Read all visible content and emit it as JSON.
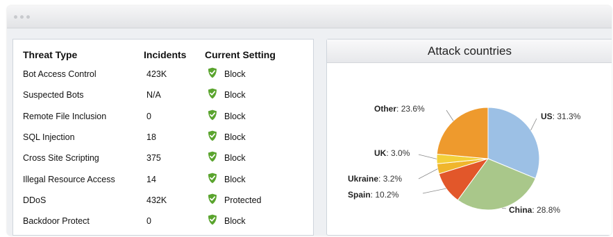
{
  "window": {},
  "table": {
    "headers": [
      "Threat Type",
      "Incidents",
      "Current Setting"
    ],
    "rows": [
      {
        "threat": "Bot Access Control",
        "incidents": "423K",
        "setting": "Block"
      },
      {
        "threat": "Suspected Bots",
        "incidents": "N/A",
        "setting": "Block"
      },
      {
        "threat": "Remote File Inclusion",
        "incidents": "0",
        "setting": "Block"
      },
      {
        "threat": "SQL Injection",
        "incidents": "18",
        "setting": "Block"
      },
      {
        "threat": "Cross Site Scripting",
        "incidents": "375",
        "setting": "Block"
      },
      {
        "threat": "Illegal Resource Access",
        "incidents": "14",
        "setting": "Block"
      },
      {
        "threat": "DDoS",
        "incidents": "432K",
        "setting": "Protected"
      },
      {
        "threat": "Backdoor Protect",
        "incidents": "0",
        "setting": "Block"
      }
    ],
    "shield_icon": "shield-check-icon",
    "shield_color": "#5aa42e"
  },
  "chart_data": {
    "type": "pie",
    "title": "Attack countries",
    "slices": [
      {
        "name": "US",
        "value": 31.3,
        "label": "31.3%",
        "color": "#9cc0e5"
      },
      {
        "name": "China",
        "value": 28.8,
        "label": "28.8%",
        "color": "#a9c78a"
      },
      {
        "name": "Spain",
        "value": 10.2,
        "label": "10.2%",
        "color": "#e2572a"
      },
      {
        "name": "Ukraine",
        "value": 3.2,
        "label": "3.2%",
        "color": "#f0b62c"
      },
      {
        "name": "UK",
        "value": 3.0,
        "label": "3.0%",
        "color": "#f3d03a"
      },
      {
        "name": "Other",
        "value": 23.6,
        "label": "23.6%",
        "color": "#ee9a2d"
      }
    ]
  }
}
